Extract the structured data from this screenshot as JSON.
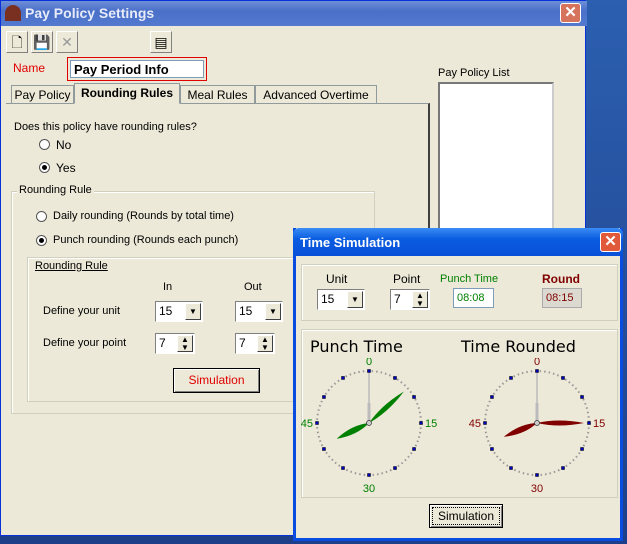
{
  "main_window": {
    "title": "Pay Policy Settings",
    "close_icon": "close-icon",
    "toolbar": [
      {
        "icon": "new-document-icon"
      },
      {
        "icon": "save-icon"
      },
      {
        "icon": "delete-icon",
        "disabled": true
      },
      {
        "icon": "report-icon"
      }
    ],
    "name_label": "Name",
    "name_value": "Pay Period Info",
    "tabs": [
      {
        "label": "Pay Policy"
      },
      {
        "label": "Rounding Rules",
        "selected": true
      },
      {
        "label": "Meal Rules"
      },
      {
        "label": "Advanced Overtime"
      }
    ],
    "pay_policy_list_label": "Pay Policy List",
    "rounding": {
      "question": "Does this policy have rounding rules?",
      "option_no": "No",
      "option_yes": "Yes",
      "selected": "Yes",
      "group_title": "Rounding Rule",
      "option_daily": "Daily rounding (Rounds by total time)",
      "option_punch": "Punch rounding (Rounds each punch)",
      "selected_type": "punch",
      "inner_title": "Rounding Rule",
      "col_in": "In",
      "col_out": "Out",
      "unit_label": "Define your unit",
      "point_label": "Define your point",
      "unit_in": "15",
      "unit_out": "15",
      "point_in": "7",
      "point_out": "7",
      "simulation_button": "Simulation"
    }
  },
  "dialog": {
    "title": "Time Simulation",
    "unit_label": "Unit",
    "unit_value": "15",
    "point_label": "Point",
    "point_value": "7",
    "punch_time_label": "Punch Time",
    "punch_time_value": "08:08",
    "round_label": "Round",
    "round_value": "08:15",
    "clock_punch_title": "Punch Time",
    "clock_rounded_title": "Time Rounded",
    "clock_labels": [
      "0",
      "15",
      "30",
      "45"
    ],
    "simulation_button": "Simulation",
    "colors": {
      "punch": "#008000",
      "round": "#800000"
    }
  }
}
